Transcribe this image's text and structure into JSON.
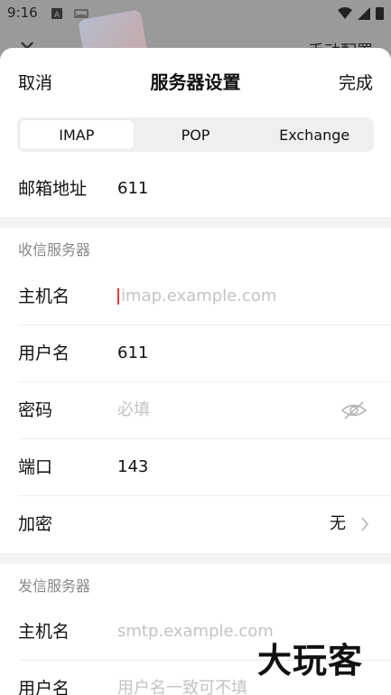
{
  "status_bar": {
    "time": "9:16"
  },
  "background": {
    "right_text": "手动配置"
  },
  "header": {
    "cancel": "取消",
    "title": "服务器设置",
    "done": "完成"
  },
  "tabs": [
    {
      "label": "IMAP",
      "active": true
    },
    {
      "label": "POP",
      "active": false
    },
    {
      "label": "Exchange",
      "active": false
    }
  ],
  "email": {
    "label": "邮箱地址",
    "value": "611"
  },
  "incoming": {
    "section": "收信服务器",
    "host_label": "主机名",
    "host_placeholder": "imap.example.com",
    "user_label": "用户名",
    "user_value": "611",
    "password_label": "密码",
    "password_placeholder": "必填",
    "port_label": "端口",
    "port_value": "143",
    "encryption_label": "加密",
    "encryption_value": "无"
  },
  "outgoing": {
    "section": "发信服务器",
    "host_label": "主机名",
    "host_placeholder": "smtp.example.com",
    "user_label": "用户名",
    "user_placeholder": "用户名一致可不填"
  },
  "watermark": "大玩客"
}
